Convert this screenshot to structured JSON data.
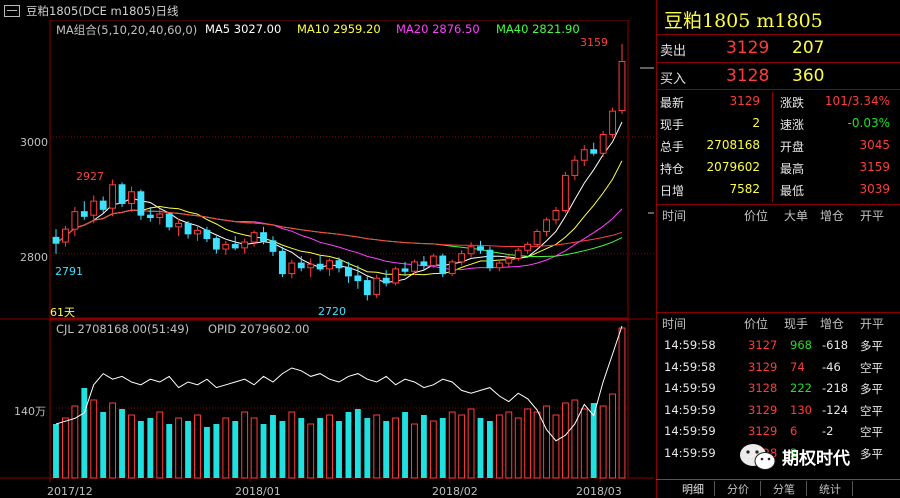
{
  "window": {
    "title": "豆粕1805(DCE m1805)日线"
  },
  "indicators": {
    "ma_group": "MA组合(5,10,20,40,60,0)",
    "ma5": "MA5 3027.00",
    "ma10": "MA10 2959.20",
    "ma20": "MA20 2876.50",
    "ma40": "MA40 2821.90",
    "colors": {
      "ma5": "#ffffff",
      "ma10": "#ffff40",
      "ma20": "#ff40ff",
      "ma40": "#40ff40",
      "ma60": "#ff4040"
    }
  },
  "volume": {
    "cjl": "CJL  2708168.00(51:49)",
    "opid": "OPID  2079602.00",
    "axis_label": "140万"
  },
  "chart_data": {
    "type": "candlestick",
    "price_axis": {
      "ticks": [
        "3000",
        "2800"
      ],
      "ylim": [
        2690,
        3200
      ]
    },
    "x_ticks": [
      "2017/12",
      "2018/01",
      "2018/02",
      "2018/03"
    ],
    "annotations": {
      "high_label": "3159",
      "peak_label": "2927",
      "low_label": "2720",
      "left_label": "2791",
      "days_label": "61天"
    },
    "ohlc": [
      [
        2828,
        2842,
        2800,
        2818
      ],
      [
        2820,
        2848,
        2812,
        2842
      ],
      [
        2842,
        2880,
        2830,
        2872
      ],
      [
        2872,
        2890,
        2858,
        2864
      ],
      [
        2866,
        2900,
        2852,
        2890
      ],
      [
        2890,
        2898,
        2870,
        2876
      ],
      [
        2878,
        2927,
        2864,
        2918
      ],
      [
        2918,
        2922,
        2880,
        2886
      ],
      [
        2886,
        2915,
        2872,
        2906
      ],
      [
        2906,
        2910,
        2858,
        2866
      ],
      [
        2866,
        2880,
        2855,
        2862
      ],
      [
        2862,
        2876,
        2850,
        2868
      ],
      [
        2868,
        2870,
        2840,
        2846
      ],
      [
        2846,
        2860,
        2830,
        2852
      ],
      [
        2852,
        2856,
        2826,
        2834
      ],
      [
        2834,
        2848,
        2822,
        2840
      ],
      [
        2840,
        2846,
        2820,
        2826
      ],
      [
        2826,
        2830,
        2800,
        2808
      ],
      [
        2808,
        2822,
        2798,
        2816
      ],
      [
        2816,
        2830,
        2806,
        2810
      ],
      [
        2810,
        2826,
        2800,
        2820
      ],
      [
        2820,
        2840,
        2812,
        2836
      ],
      [
        2836,
        2846,
        2816,
        2822
      ],
      [
        2822,
        2830,
        2796,
        2804
      ],
      [
        2804,
        2812,
        2760,
        2766
      ],
      [
        2766,
        2790,
        2758,
        2784
      ],
      [
        2784,
        2796,
        2770,
        2776
      ],
      [
        2776,
        2792,
        2760,
        2782
      ],
      [
        2782,
        2796,
        2770,
        2774
      ],
      [
        2774,
        2792,
        2762,
        2788
      ],
      [
        2788,
        2794,
        2768,
        2776
      ],
      [
        2776,
        2786,
        2750,
        2762
      ],
      [
        2762,
        2780,
        2740,
        2754
      ],
      [
        2754,
        2762,
        2720,
        2730
      ],
      [
        2730,
        2764,
        2724,
        2758
      ],
      [
        2758,
        2772,
        2744,
        2750
      ],
      [
        2750,
        2778,
        2746,
        2774
      ],
      [
        2774,
        2786,
        2762,
        2770
      ],
      [
        2770,
        2790,
        2764,
        2786
      ],
      [
        2786,
        2796,
        2772,
        2780
      ],
      [
        2780,
        2800,
        2776,
        2796
      ],
      [
        2796,
        2800,
        2760,
        2766
      ],
      [
        2766,
        2790,
        2762,
        2786
      ],
      [
        2786,
        2806,
        2780,
        2800
      ],
      [
        2800,
        2820,
        2794,
        2812
      ],
      [
        2812,
        2822,
        2800,
        2806
      ],
      [
        2806,
        2812,
        2770,
        2776
      ],
      [
        2776,
        2790,
        2770,
        2784
      ],
      [
        2784,
        2800,
        2778,
        2792
      ],
      [
        2792,
        2810,
        2788,
        2806
      ],
      [
        2806,
        2820,
        2800,
        2816
      ],
      [
        2816,
        2842,
        2812,
        2838
      ],
      [
        2838,
        2862,
        2830,
        2858
      ],
      [
        2858,
        2880,
        2850,
        2874
      ],
      [
        2874,
        2940,
        2870,
        2934
      ],
      [
        2934,
        2968,
        2926,
        2960
      ],
      [
        2960,
        2986,
        2950,
        2978
      ],
      [
        2978,
        2990,
        2968,
        2972
      ],
      [
        2972,
        3010,
        2966,
        3004
      ],
      [
        3004,
        3050,
        2998,
        3044
      ],
      [
        3045,
        3159,
        3039,
        3129
      ]
    ],
    "volume_bars": [
      36,
      40,
      48,
      60,
      52,
      44,
      50,
      46,
      42,
      38,
      40,
      44,
      36,
      40,
      38,
      42,
      34,
      36,
      40,
      38,
      44,
      40,
      36,
      42,
      38,
      44,
      40,
      36,
      40,
      42,
      38,
      44,
      46,
      40,
      42,
      38,
      40,
      44,
      36,
      42,
      38,
      40,
      44,
      42,
      46,
      40,
      38,
      42,
      44,
      40,
      46,
      44,
      48,
      42,
      50,
      52,
      46,
      50,
      48,
      56,
      100
    ],
    "opid_line": [
      30,
      32,
      34,
      38,
      58,
      66,
      62,
      64,
      60,
      58,
      62,
      60,
      64,
      56,
      60,
      58,
      62,
      56,
      58,
      60,
      62,
      58,
      64,
      60,
      66,
      70,
      68,
      64,
      66,
      62,
      60,
      64,
      66,
      62,
      60,
      64,
      58,
      62,
      60,
      56,
      58,
      62,
      60,
      54,
      52,
      54,
      56,
      50,
      46,
      52,
      48,
      40,
      26,
      18,
      22,
      30,
      44,
      36,
      60,
      80,
      100
    ]
  },
  "quote": {
    "title": "豆粕1805 m1805",
    "sell_label": "卖出",
    "sell_price": "3129",
    "sell_qty": "207",
    "buy_label": "买入",
    "buy_price": "3128",
    "buy_qty": "360",
    "stats": [
      {
        "l1": "最新",
        "v1": "3129",
        "c1": "red",
        "l2": "涨跌",
        "v2": "101/3.34%",
        "c2": "red"
      },
      {
        "l1": "现手",
        "v1": "2",
        "c1": "yel",
        "l2": "速涨",
        "v2": "-0.03%",
        "c2": "grn"
      },
      {
        "l1": "总手",
        "v1": "2708168",
        "c1": "yel",
        "l2": "开盘",
        "v2": "3045",
        "c2": "red"
      },
      {
        "l1": "持仓",
        "v1": "2079602",
        "c1": "yel",
        "l2": "最高",
        "v2": "3159",
        "c2": "red"
      },
      {
        "l1": "日增",
        "v1": "7582",
        "c1": "yel",
        "l2": "最低",
        "v2": "3039",
        "c2": "red"
      }
    ],
    "bigorder_headers": [
      "时间",
      "价位",
      "大单",
      "增仓",
      "开平"
    ],
    "tick_headers": [
      "时间",
      "价位",
      "现手",
      "增仓",
      "开平"
    ],
    "ticks": [
      {
        "time": "14:59:58",
        "price": "3127",
        "qty": "968",
        "qc": "grn",
        "chg": "-618",
        "type": "多平"
      },
      {
        "time": "14:59:58",
        "price": "3129",
        "qty": "74",
        "qc": "red",
        "chg": "-46",
        "type": "空平"
      },
      {
        "time": "14:59:59",
        "price": "3128",
        "qty": "222",
        "qc": "grn",
        "chg": "-218",
        "type": "多平"
      },
      {
        "time": "14:59:59",
        "price": "3129",
        "qty": "130",
        "qc": "red",
        "chg": "-124",
        "type": "空平"
      },
      {
        "time": "14:59:59",
        "price": "3129",
        "qty": "6",
        "qc": "red",
        "chg": "-2",
        "type": "空平"
      },
      {
        "time": "14:59:59",
        "price": "3128",
        "qty": "2",
        "qc": "grn",
        "chg": "",
        "type": "多平"
      }
    ],
    "tabs": [
      "明细",
      "分价",
      "分笔",
      "统计"
    ]
  },
  "watermark": {
    "text": "期权时代",
    "icon": "wechat-icon"
  }
}
